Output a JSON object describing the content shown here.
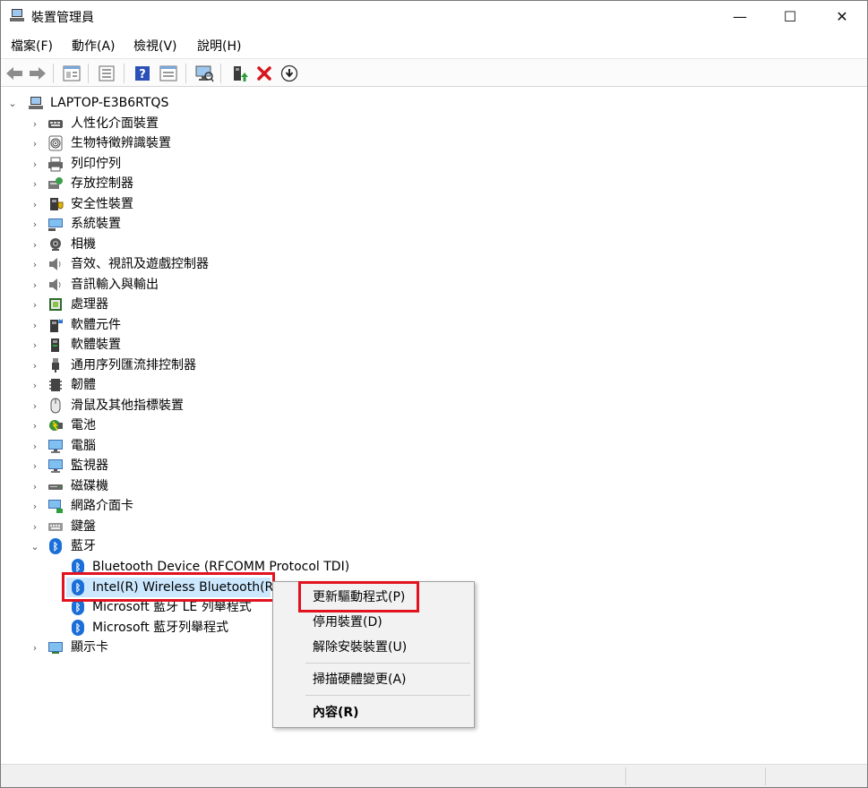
{
  "window": {
    "title": "裝置管理員",
    "controls": {
      "minimize": "—",
      "maximize": "☐",
      "close": "✕"
    }
  },
  "menu": {
    "items": [
      {
        "label": "檔案(F)"
      },
      {
        "label": "動作(A)"
      },
      {
        "label": "檢視(V)"
      },
      {
        "label": "說明(H)"
      }
    ]
  },
  "toolbar": {
    "icons": [
      "back-arrow-icon",
      "forward-arrow-icon",
      "properties-view-icon",
      "device-list-icon",
      "help-icon",
      "view-icon",
      "scan-hardware-icon",
      "update-driver-icon",
      "uninstall-icon",
      "disable-device-icon"
    ]
  },
  "tree": {
    "root": "LAPTOP-E3B6RTQS",
    "categories": [
      {
        "label": "人性化介面裝置",
        "icon": "hid-icon"
      },
      {
        "label": "生物特徵辨識裝置",
        "icon": "fingerprint-icon"
      },
      {
        "label": "列印佇列",
        "icon": "printer-icon"
      },
      {
        "label": "存放控制器",
        "icon": "storage-controller-icon"
      },
      {
        "label": "安全性裝置",
        "icon": "security-device-icon"
      },
      {
        "label": "系統裝置",
        "icon": "system-device-icon"
      },
      {
        "label": "相機",
        "icon": "camera-icon"
      },
      {
        "label": "音效、視訊及遊戲控制器",
        "icon": "speaker-icon"
      },
      {
        "label": "音訊輸入與輸出",
        "icon": "audio-io-icon"
      },
      {
        "label": "處理器",
        "icon": "processor-icon"
      },
      {
        "label": "軟體元件",
        "icon": "software-component-icon"
      },
      {
        "label": "軟體裝置",
        "icon": "software-device-icon"
      },
      {
        "label": "通用序列匯流排控制器",
        "icon": "usb-icon"
      },
      {
        "label": "韌體",
        "icon": "firmware-icon"
      },
      {
        "label": "滑鼠及其他指標裝置",
        "icon": "mouse-icon"
      },
      {
        "label": "電池",
        "icon": "battery-icon"
      },
      {
        "label": "電腦",
        "icon": "computer-icon"
      },
      {
        "label": "監視器",
        "icon": "monitor-icon"
      },
      {
        "label": "磁碟機",
        "icon": "disk-drive-icon"
      },
      {
        "label": "網路介面卡",
        "icon": "network-adapter-icon"
      },
      {
        "label": "鍵盤",
        "icon": "keyboard-icon"
      },
      {
        "label": "藍牙",
        "icon": "bluetooth-icon"
      }
    ],
    "bluetooth_children": [
      {
        "label": "Bluetooth Device (RFCOMM Protocol TDI)"
      },
      {
        "label": "Intel(R) Wireless Bluetooth(R)"
      },
      {
        "label": "Microsoft 藍牙 LE 列舉程式"
      },
      {
        "label": "Microsoft 藍牙列舉程式"
      }
    ],
    "last_category": {
      "label": "顯示卡",
      "icon": "display-adapter-icon"
    }
  },
  "context_menu": {
    "items": [
      {
        "label": "更新驅動程式(P)"
      },
      {
        "label": "停用裝置(D)"
      },
      {
        "label": "解除安裝裝置(U)"
      },
      {
        "label": "掃描硬體變更(A)"
      },
      {
        "label": "內容(R)"
      }
    ]
  },
  "colors": {
    "highlight_border": "#e0131f",
    "selection": "#cce8ff",
    "bluetooth": "#1b6fd8"
  }
}
